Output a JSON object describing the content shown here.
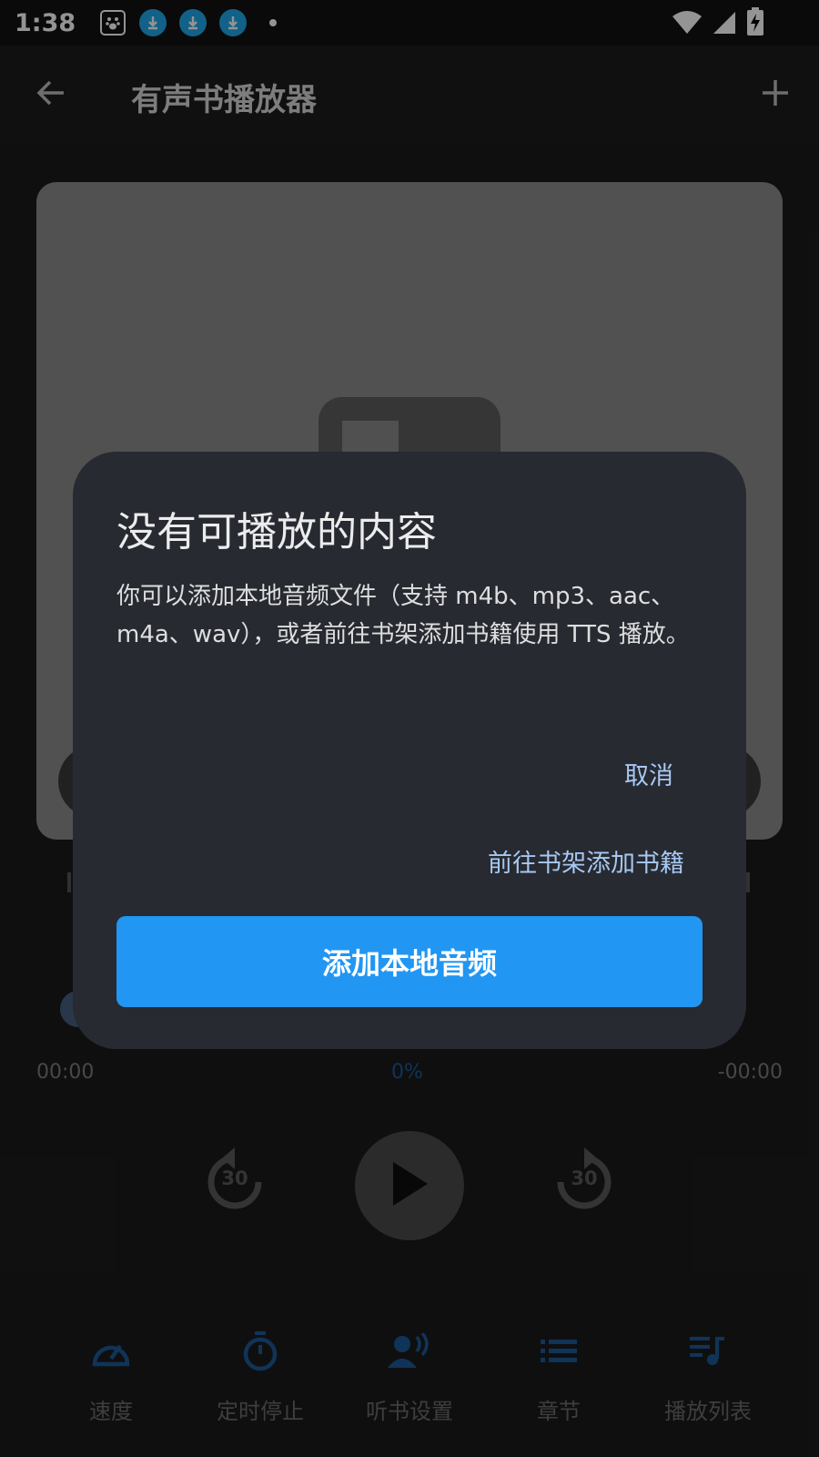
{
  "status_bar": {
    "time": "1:38",
    "icons": [
      "baidu-icon",
      "download-icon",
      "download-icon",
      "download-icon",
      "dot-icon",
      "wifi-icon",
      "signal-icon",
      "battery-charging-icon"
    ]
  },
  "app_bar": {
    "title": "有声书播放器",
    "back_icon": "arrow-left-icon",
    "add_icon": "plus-icon"
  },
  "player": {
    "time_elapsed": "00:00",
    "progress_percent": "0%",
    "time_remaining": "-00:00",
    "rewind_seconds": "30",
    "forward_seconds": "30"
  },
  "bottom_nav": {
    "items": [
      {
        "label": "速度",
        "icon": "speedometer-icon"
      },
      {
        "label": "定时停止",
        "icon": "timer-icon"
      },
      {
        "label": "听书设置",
        "icon": "voice-settings-icon"
      },
      {
        "label": "章节",
        "icon": "list-icon"
      },
      {
        "label": "播放列表",
        "icon": "playlist-icon"
      }
    ]
  },
  "dialog": {
    "title": "没有可播放的内容",
    "body": "你可以添加本地音频文件（支持 m4b、mp3、aac、m4a、wav），或者前往书架添加书籍使用 TTS 播放。",
    "cancel_label": "取消",
    "shelf_label": "前往书架添加书籍",
    "add_local_label": "添加本地音频"
  },
  "colors": {
    "accent": "#2196f3",
    "dialog_bg": "#272a31",
    "text_button": "#a7c8f2",
    "nav_icon": "#1c5a98"
  }
}
